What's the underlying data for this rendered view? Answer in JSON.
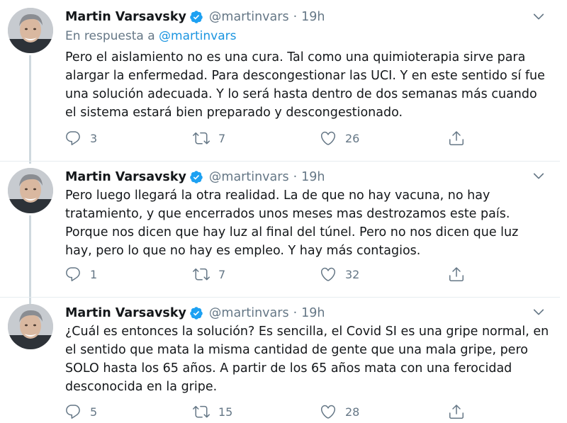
{
  "colors": {
    "text": "#14171a",
    "muted": "#657786",
    "link": "#1b95e0",
    "verified": "#1da1f2",
    "divider": "#e6ecf0",
    "thread_line": "#cfd9de"
  },
  "tweets": [
    {
      "name": "Martin Varsavsky",
      "handle": "@martinvars",
      "separator": "·",
      "time": "19h",
      "reply_prefix": "En respuesta a ",
      "reply_mention": "@martinvars",
      "lines": [
        "Pero el aislamiento no es una cura. Tal como una quimioterapia sirve para",
        "alargar la enfermedad. Para descongestionar las UCI. Y en este sentido sí fue",
        "una solución adecuada. Y lo será hasta dentro de dos semanas más cuando",
        "el sistema estará bien preparado y descongestionado."
      ],
      "replies": "3",
      "retweets": "7",
      "likes": "26"
    },
    {
      "name": "Martin Varsavsky",
      "handle": "@martinvars",
      "separator": "·",
      "time": "19h",
      "lines": [
        "Pero luego llegará la otra realidad. La de que no hay vacuna, no hay",
        "tratamiento, y que encerrados unos meses mas destrozamos este país.",
        "Porque nos dicen que hay luz al final del túnel. Pero no nos dicen que luz",
        "hay, pero lo que no hay es empleo. Y hay más contagios."
      ],
      "replies": "1",
      "retweets": "7",
      "likes": "32"
    },
    {
      "name": "Martin Varsavsky",
      "handle": "@martinvars",
      "separator": "·",
      "time": "19h",
      "lines": [
        "¿Cuál es entonces la solución? Es sencilla, el Covid SI es una gripe normal, en",
        "el sentido que mata la misma cantidad de gente que una mala gripe, pero",
        "SOLO hasta los 65 años. A partir de los 65 años mata con una ferocidad",
        "desconocida en la gripe."
      ],
      "replies": "5",
      "retweets": "15",
      "likes": "28"
    }
  ],
  "icons": {
    "avatar": "profile-photo",
    "verified": "verified-badge-icon",
    "caret": "chevron-down-icon",
    "reply": "reply-bubble-icon",
    "retweet": "retweet-icon",
    "like": "heart-icon",
    "share": "share-upload-icon"
  }
}
